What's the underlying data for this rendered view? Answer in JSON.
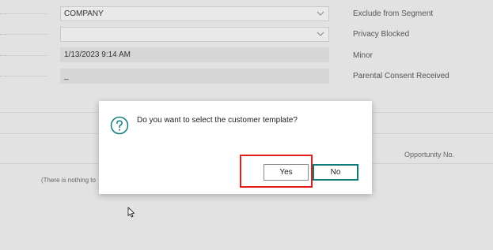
{
  "form": {
    "left_fields": [
      {
        "type": "select",
        "value": "COMPANY"
      },
      {
        "type": "select",
        "value": ""
      },
      {
        "type": "readonly",
        "value": "1/13/2023 9:14 AM"
      },
      {
        "type": "readonly",
        "value": "_"
      }
    ],
    "right_labels": [
      "Exclude from Segment",
      "Privacy Blocked",
      "Minor",
      "Parental Consent Received"
    ]
  },
  "list": {
    "column_header": "Opportunity No.",
    "empty_message": "(There is nothing to"
  },
  "dialog": {
    "message": "Do you want to select the customer template?",
    "icon": "question-circle-icon",
    "yes_label": "Yes",
    "no_label": "No",
    "accent_color": "#0f7b7b",
    "highlight_color": "#e31b1b"
  }
}
